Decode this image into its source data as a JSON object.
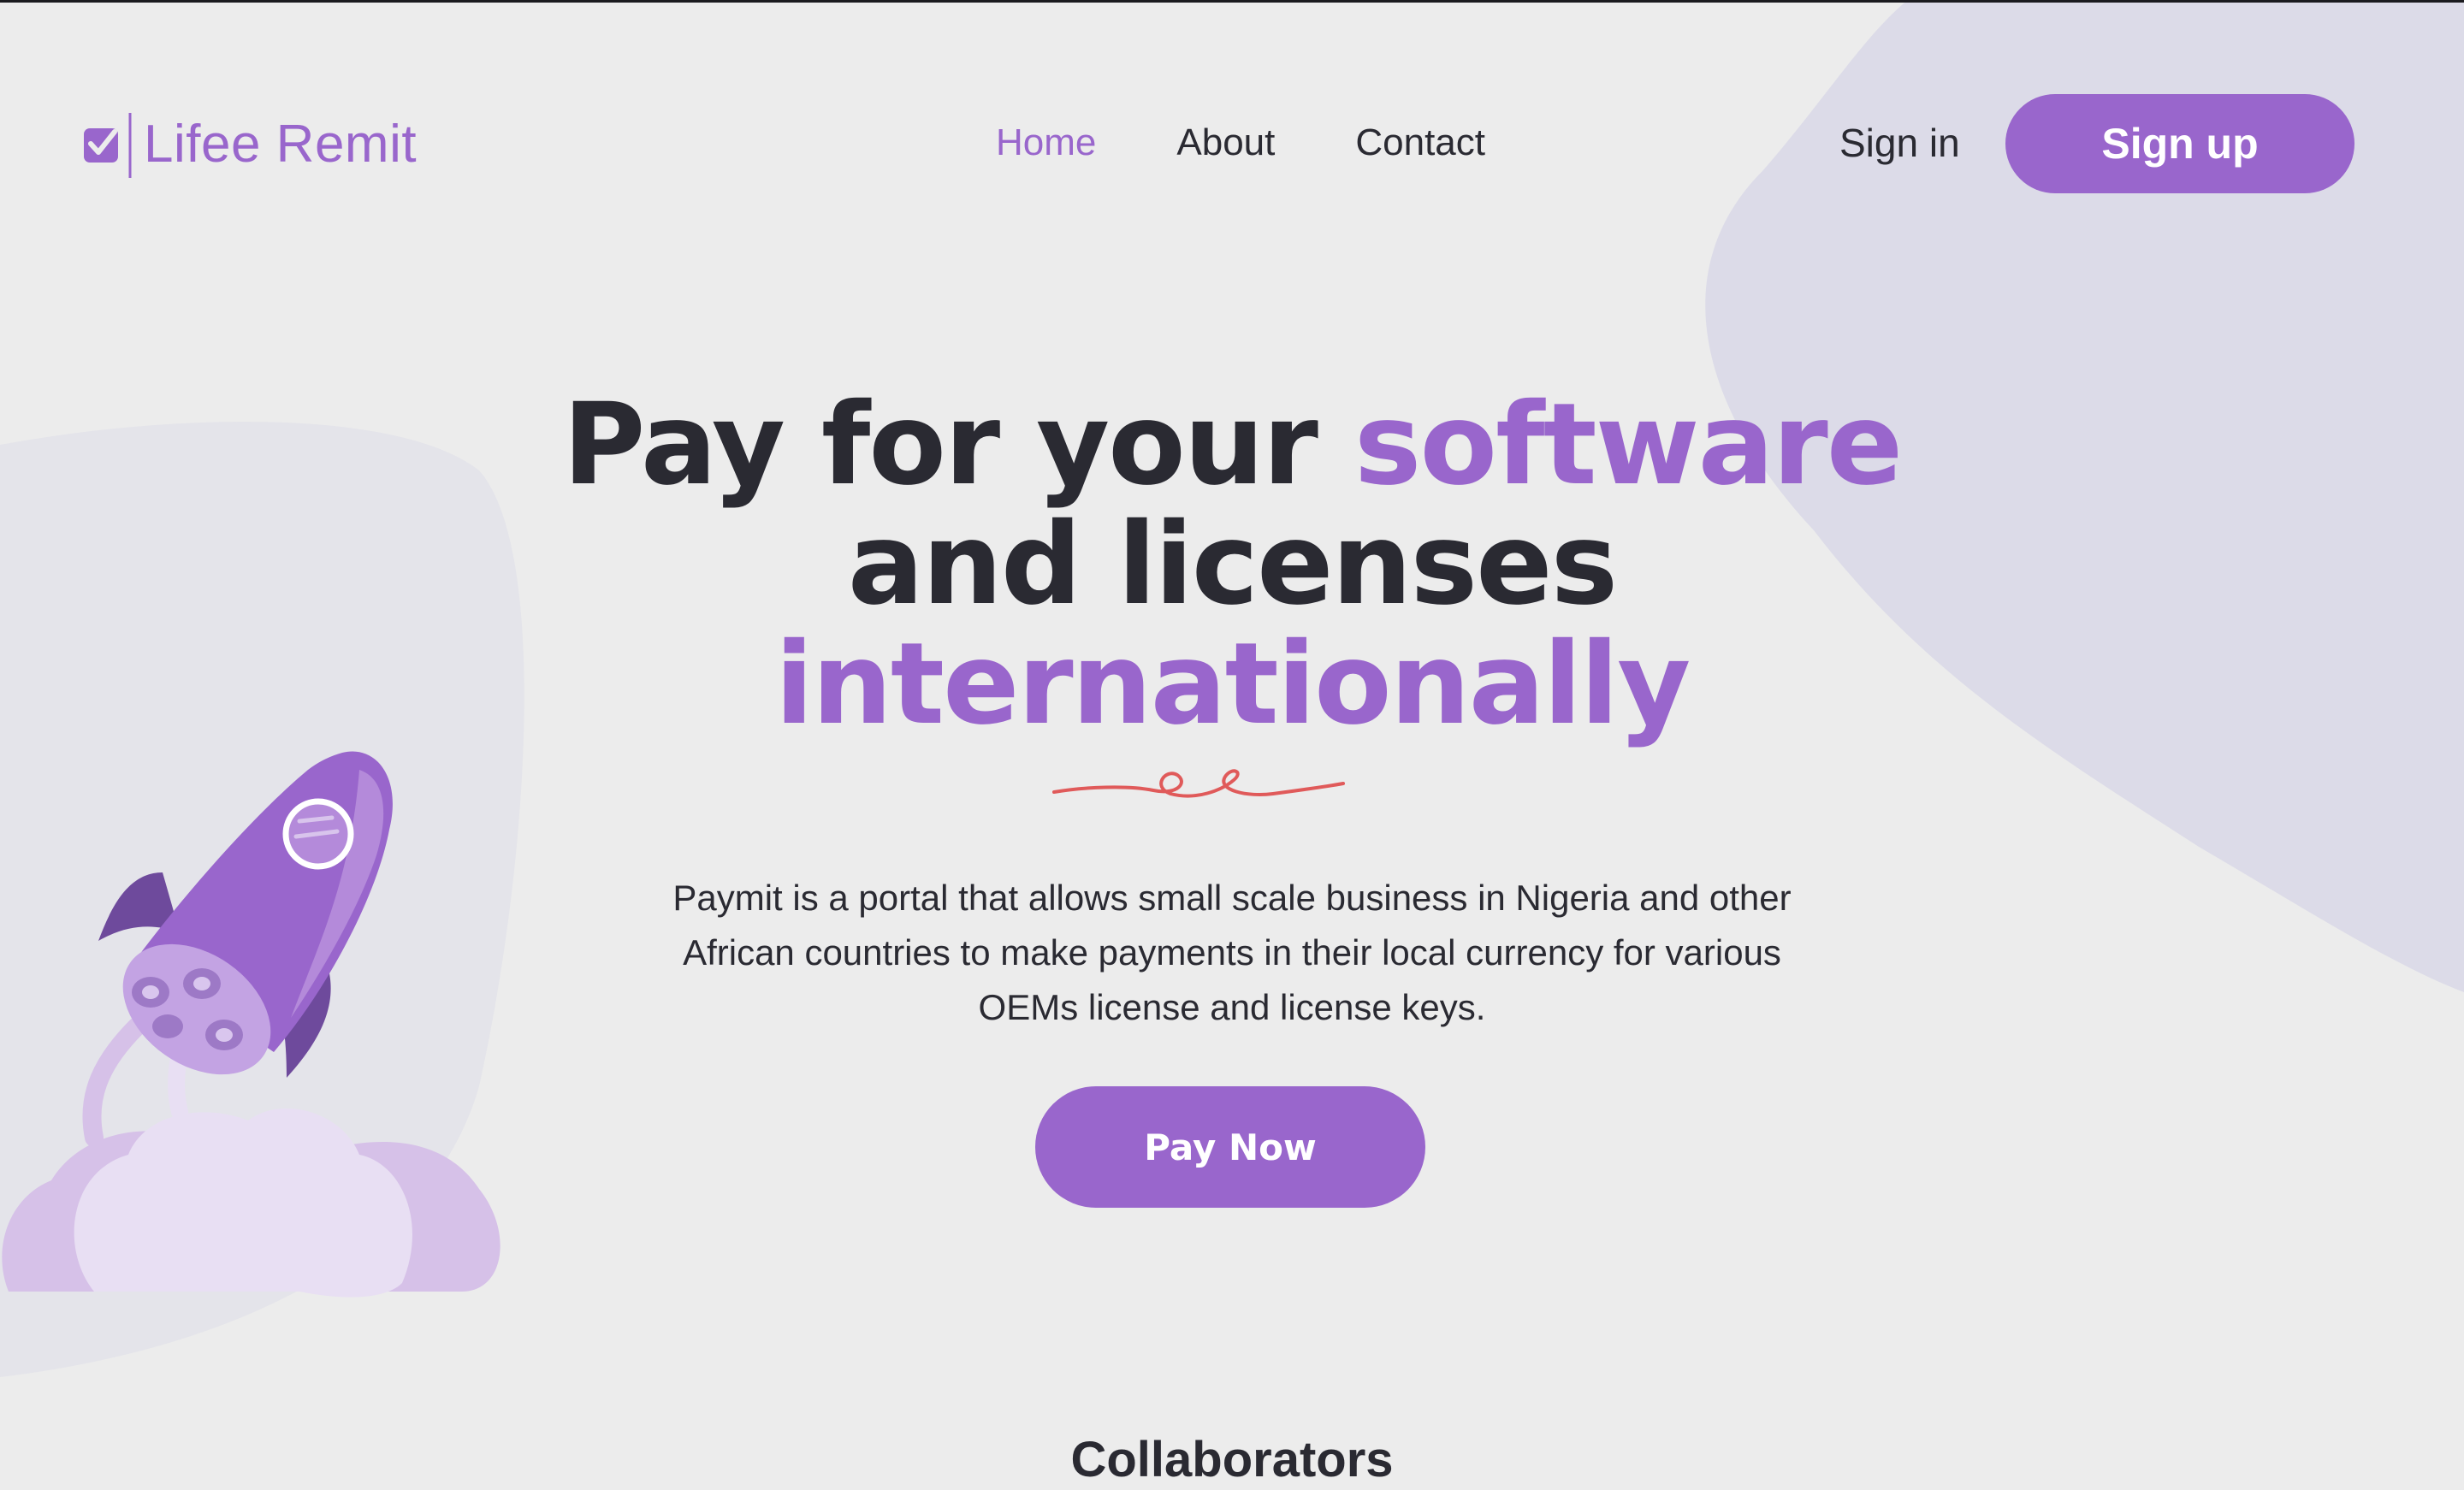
{
  "brand": {
    "name": "Lifee Remit",
    "logo_icon": "checkbox-icon",
    "accent_color": "#9966CC",
    "text_color": "#2A2A32",
    "background_color": "#ECECEC"
  },
  "nav": {
    "links": [
      {
        "label": "Home",
        "active": true
      },
      {
        "label": "About",
        "active": false
      },
      {
        "label": "Contact",
        "active": false
      }
    ],
    "signin_label": "Sign in",
    "signup_label": "Sign up"
  },
  "hero": {
    "title_line1_dark": "Pay for your",
    "title_line1_accent": "software",
    "title_line2": "and licenses",
    "title_line3": "internationally",
    "description": "Paymit is a portal that allows small scale business in Nigeria and other African countries to make payments in their local currency for various OEMs license and license keys.",
    "cta_label": "Pay Now",
    "illustration": "rocket-illustration",
    "underline_color": "#E05A5A"
  },
  "collaborators": {
    "heading": "Collaborators"
  }
}
